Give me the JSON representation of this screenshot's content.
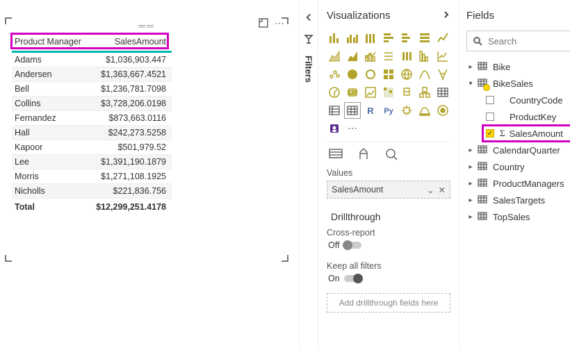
{
  "canvas": {
    "table": {
      "headers": [
        "Product Manager",
        "SalesAmount"
      ],
      "rows": [
        {
          "name": "Adams",
          "value": "$1,036,903.447"
        },
        {
          "name": "Andersen",
          "value": "$1,363,667.4521"
        },
        {
          "name": "Bell",
          "value": "$1,236,781.7098"
        },
        {
          "name": "Collins",
          "value": "$3,728,206.0198"
        },
        {
          "name": "Fernandez",
          "value": "$873,663.0116"
        },
        {
          "name": "Hall",
          "value": "$242,273.5258"
        },
        {
          "name": "Kapoor",
          "value": "$501,979.52"
        },
        {
          "name": "Lee",
          "value": "$1,391,190.1879"
        },
        {
          "name": "Morris",
          "value": "$1,271,108.1925"
        },
        {
          "name": "Nicholls",
          "value": "$221,836.756"
        }
      ],
      "total_label": "Total",
      "total_value": "$12,299,251.4178"
    }
  },
  "filters": {
    "label": "Filters"
  },
  "viz": {
    "title": "Visualizations",
    "values_label": "Values",
    "values_field": "SalesAmount",
    "drillthrough": "Drillthrough",
    "cross_report": "Cross-report",
    "off": "Off",
    "keep_filters": "Keep all filters",
    "on": "On",
    "drill_placeholder": "Add drillthrough fields here",
    "r_label": "R",
    "py_label": "Py",
    "ellipsis": "⋯"
  },
  "fields": {
    "title": "Fields",
    "search_placeholder": "Search",
    "tables": [
      {
        "name": "Bike",
        "expanded": false
      },
      {
        "name": "BikeSales",
        "expanded": true,
        "active": true,
        "columns": [
          {
            "name": "CountryCode",
            "checked": false
          },
          {
            "name": "ProductKey",
            "checked": false
          },
          {
            "name": "SalesAmount",
            "checked": true,
            "sigma": true,
            "highlight": true
          }
        ]
      },
      {
        "name": "CalendarQuarter",
        "expanded": false
      },
      {
        "name": "Country",
        "expanded": false
      },
      {
        "name": "ProductManagers",
        "expanded": false
      },
      {
        "name": "SalesTargets",
        "expanded": false
      },
      {
        "name": "TopSales",
        "expanded": false
      }
    ]
  }
}
